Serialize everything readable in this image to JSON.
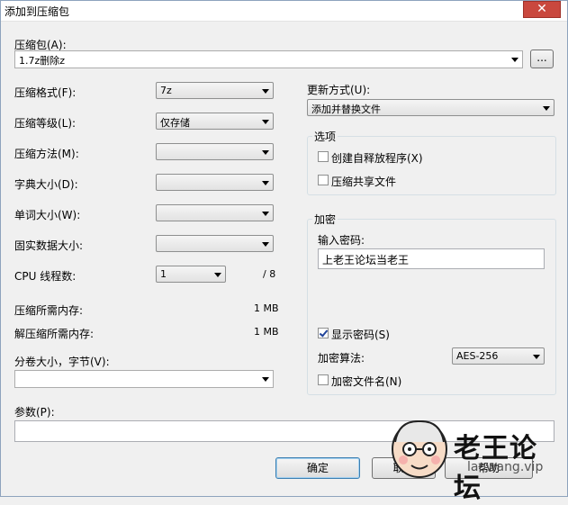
{
  "window": {
    "title": "添加到压缩包",
    "close_glyph": "✕"
  },
  "archive": {
    "label": "压缩包(A):",
    "value": "1.7z删除z",
    "browse_label": "..."
  },
  "format": {
    "label": "压缩格式(F):",
    "value": "7z"
  },
  "level": {
    "label": "压缩等级(L):",
    "value": "仅存储"
  },
  "method": {
    "label": "压缩方法(M):",
    "value": ""
  },
  "dict": {
    "label": "字典大小(D):",
    "value": ""
  },
  "word": {
    "label": "单词大小(W):",
    "value": ""
  },
  "solid": {
    "label": "固实数据大小:",
    "value": ""
  },
  "cpu": {
    "label": "CPU 线程数:",
    "value": "1",
    "max": "/ 8"
  },
  "mem_compress": {
    "label": "压缩所需内存:",
    "value": "1 MB"
  },
  "mem_decompress": {
    "label": "解压缩所需内存:",
    "value": "1 MB"
  },
  "volume": {
    "label": "分卷大小，字节(V):",
    "value": ""
  },
  "params": {
    "label": "参数(P):",
    "value": ""
  },
  "update": {
    "label": "更新方式(U):",
    "value": "添加并替换文件"
  },
  "options": {
    "title": "选项",
    "sfx_label": "创建自释放程序(X)",
    "sfx_checked": false,
    "shared_label": "压缩共享文件",
    "shared_checked": false
  },
  "encryption": {
    "title": "加密",
    "password_label": "输入密码:",
    "password_value": "上老王论坛当老王",
    "show_password_label": "显示密码(S)",
    "show_password_checked": true,
    "method_label": "加密算法:",
    "method_value": "AES-256",
    "encrypt_names_label": "加密文件名(N)",
    "encrypt_names_checked": false
  },
  "buttons": {
    "ok": "确定",
    "cancel": "取消",
    "help": "帮助"
  },
  "watermark": {
    "text": "老王论坛",
    "url": "laowang.vip"
  }
}
